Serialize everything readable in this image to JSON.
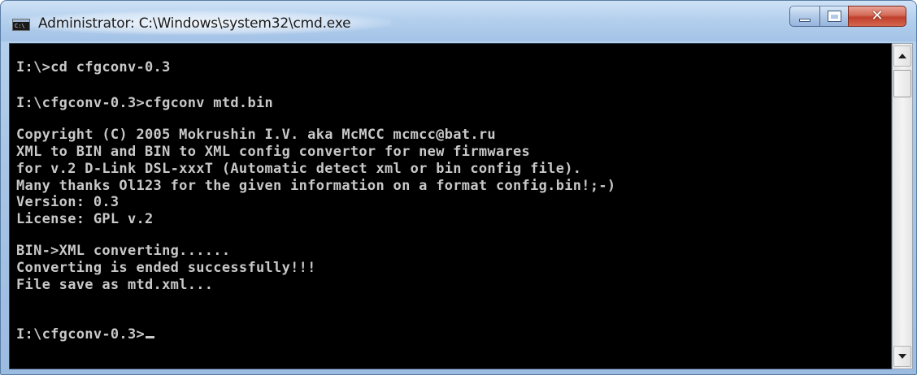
{
  "window": {
    "title": "Administrator: C:\\Windows\\system32\\cmd.exe",
    "icon": "console-window-icon",
    "icon_text": "C:\\"
  },
  "controls": {
    "minimize_icon": "minimize-icon",
    "maximize_icon": "maximize-icon",
    "close_icon": "close-icon",
    "close_glyph": "✕",
    "close_color": "#c7412d"
  },
  "console": {
    "background": "#000000",
    "foreground": "#c8c8c8",
    "lines": [
      "I:\\>cd cfgconv-0.3",
      "I:\\cfgconv-0.3>cfgconv mtd.bin",
      "Copyright (C) 2005 Mokrushin I.V. aka McMCC mcmcc@bat.ru",
      "XML to BIN and BIN to XML config convertor for new firmwares",
      "for v.2 D-Link DSL-xxxT (Automatic detect xml or bin config file).",
      "Many thanks Ol123 for the given information on a format config.bin!;-)",
      "Version: 0.3",
      "License: GPL v.2",
      "BIN->XML converting......",
      "Converting is ended successfully!!!",
      "File save as mtd.xml...",
      "I:\\cfgconv-0.3>"
    ]
  },
  "scrollbar": {
    "up_icon": "scroll-up-arrow-icon",
    "down_icon": "scroll-down-arrow-icon"
  }
}
